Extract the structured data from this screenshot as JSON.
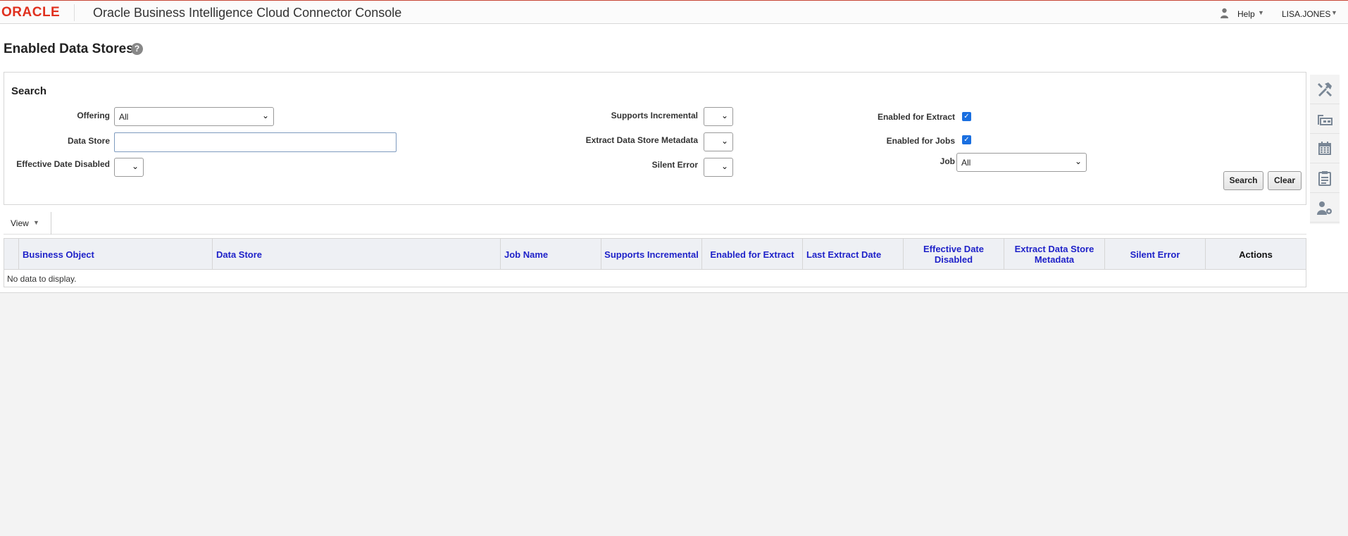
{
  "header": {
    "logo": "ORACLE",
    "app_title": "Oracle Business Intelligence Cloud Connector Console",
    "help_label": "Help",
    "user_label": "LISA.JONES"
  },
  "page": {
    "title": "Enabled Data Stores",
    "help_glyph": "?"
  },
  "search": {
    "title": "Search",
    "offering_label": "Offering",
    "offering_value": "All",
    "data_store_label": "Data Store",
    "data_store_value": "",
    "effective_date_disabled_label": "Effective Date Disabled",
    "effective_date_disabled_value": "",
    "supports_incremental_label": "Supports Incremental",
    "supports_incremental_value": "",
    "extract_metadata_label": "Extract Data Store Metadata",
    "extract_metadata_value": "",
    "silent_error_label": "Silent Error",
    "silent_error_value": "",
    "enabled_for_extract_label": "Enabled for Extract",
    "enabled_for_extract_checked": true,
    "enabled_for_jobs_label": "Enabled for Jobs",
    "enabled_for_jobs_checked": true,
    "job_label": "Job",
    "job_value": "All",
    "search_button": "Search",
    "clear_button": "Clear"
  },
  "toolbar": {
    "view_label": "View"
  },
  "table": {
    "columns": [
      "Business Object",
      "Data Store",
      "Job Name",
      "Supports Incremental",
      "Enabled for Extract",
      "Last Extract Date",
      "Effective Date Disabled",
      "Extract Data Store Metadata",
      "Silent Error",
      "Actions"
    ],
    "empty_message": "No data to display."
  },
  "rail": {
    "icons": [
      "tools-icon",
      "data-store-icon",
      "calendar-icon",
      "clipboard-icon",
      "user-settings-icon"
    ]
  },
  "colors": {
    "brand_red": "#e0301e",
    "link_blue": "#1f22c9",
    "checkbox_blue": "#1a6fe0"
  }
}
